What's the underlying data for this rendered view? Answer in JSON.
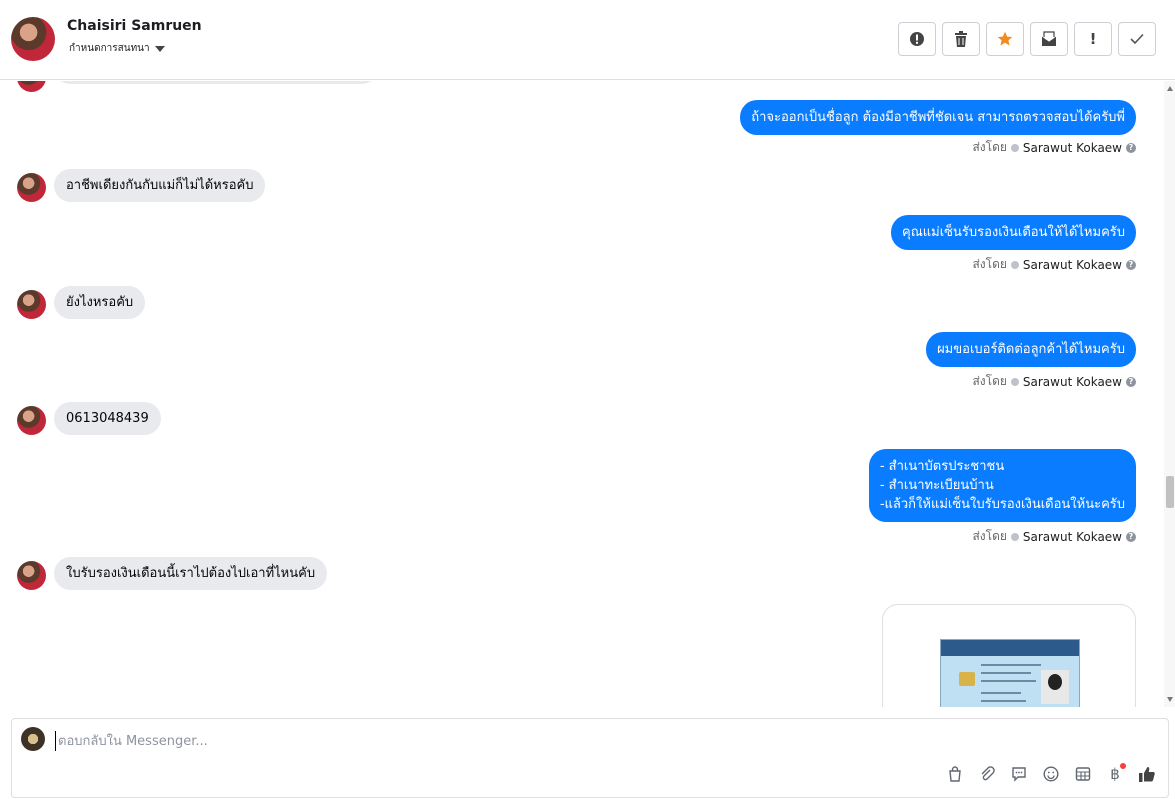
{
  "header": {
    "contact_name": "Chaisiri Samruen",
    "subtitle": "กำหนดการสนทนา",
    "toolbar": [
      {
        "name": "spam-button",
        "glyph": "!"
      },
      {
        "name": "delete-button",
        "glyph": "🗑"
      },
      {
        "name": "star-button",
        "glyph": "★"
      },
      {
        "name": "mark-unread-button",
        "glyph": "✉"
      },
      {
        "name": "follow-up-button",
        "glyph": "!"
      },
      {
        "name": "done-button",
        "glyph": "✓"
      }
    ]
  },
  "messages": {
    "sender_label": "ส่งโดย",
    "sender_name": "Sarawut Kokaew",
    "m1_out": "ถ้าจะออกเป็นชื่อลูก ต้องมีอาชีพที่ชัดเจน สามารถตรวจสอบได้ครับพี่",
    "m2_in": "อาชีพเดียงกันกับแม่ก็ไม่ได้หรอคับ",
    "m3_out": "คุณแม่เซ็นรับรองเงินเดือนให้ได้ไหมครับ",
    "m4_in": "ยังไงหรอคับ",
    "m5_out": "ผมขอเบอร์ติดต่อลูกค้าได้ไหมครับ",
    "m6_in": "0613048439",
    "m7_out_line1": "- สำเนาบัตรประชาชน",
    "m7_out_line2": "- สำเนาทะเบียนบ้าน",
    "m7_out_line3": "-แล้วก็ให้แม่เซ็นใบรับรองเงินเดือนให้นะครับ",
    "m8_in": "ใบรับรองเงินเดือนนี้เราไปต้องไปเอาที่ไหนคับ"
  },
  "composer": {
    "placeholder": "ตอบกลับใน Messenger..."
  }
}
